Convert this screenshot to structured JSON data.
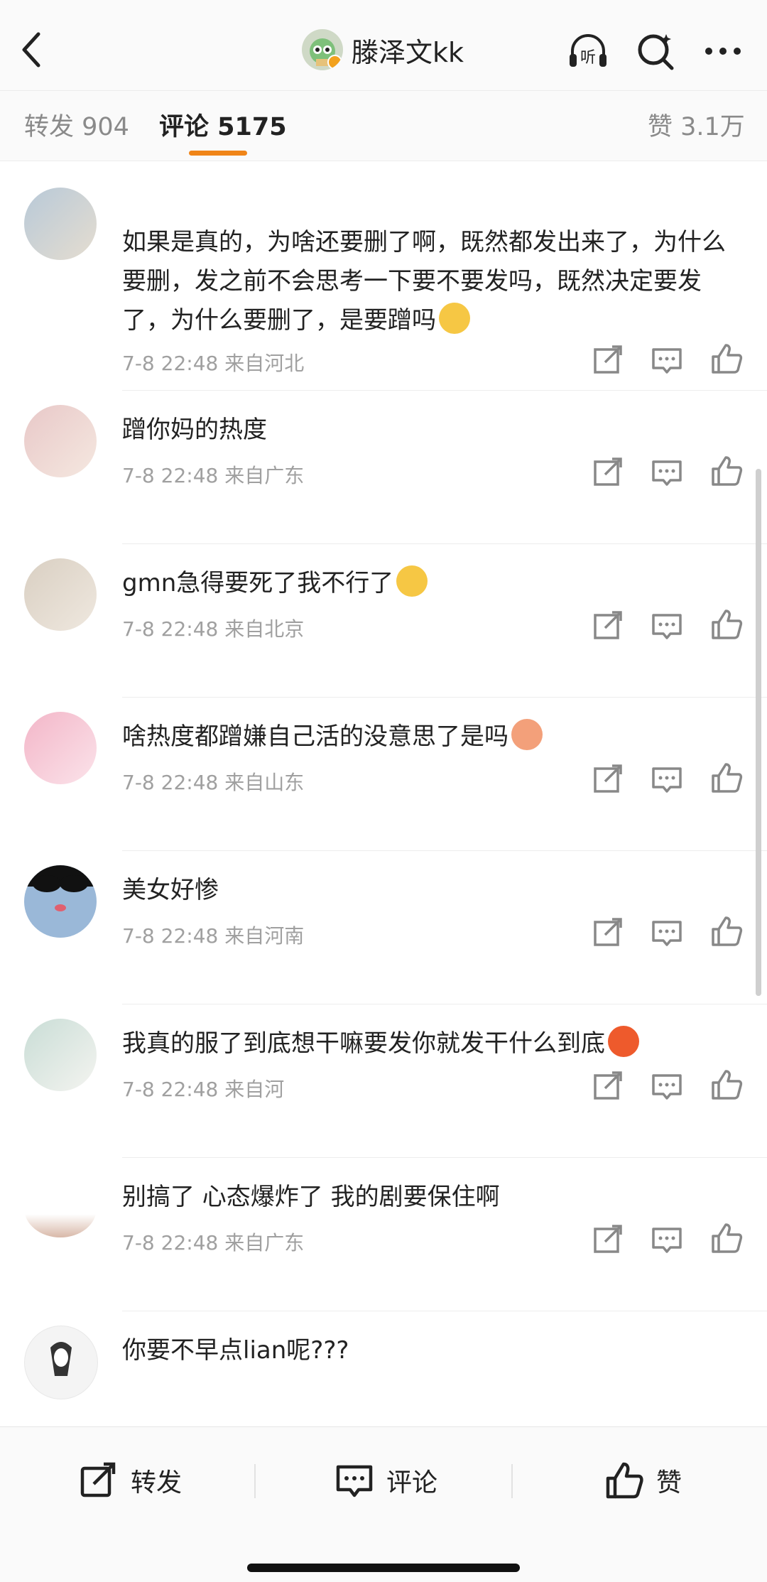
{
  "header": {
    "title": "滕泽文kk",
    "listen_label": "听"
  },
  "tabs": {
    "repost_label": "转发 904",
    "comment_label": "评论 5175",
    "like_label": "赞 3.1万"
  },
  "comments": [
    {
      "text": "如果是真的，为啥还要删了啊，既然都发出来了，为什么要删，发之前不会思考一下要不要发吗，既然决定要发了，为什么要删了，是要蹭吗",
      "meta": "7-8 22:48 来自河北",
      "emoji_color": "#f6c744"
    },
    {
      "text": "蹭你妈的热度",
      "meta": "7-8 22:48 来自广东"
    },
    {
      "text": "gmn急得要死了我不行了",
      "meta": "7-8 22:48 来自北京",
      "emoji_color": "#f6c744"
    },
    {
      "text": "啥热度都蹭嫌自己活的没意思了是吗",
      "meta": "7-8 22:48 来自山东",
      "emoji_color": "#f3a07a"
    },
    {
      "text": "美女好惨",
      "meta": "7-8 22:48 来自河南"
    },
    {
      "text": "我真的服了到底想干嘛要发你就发干什么到底",
      "meta": "7-8 22:48 来自河",
      "emoji_color": "#ee5a2c"
    },
    {
      "text": "别搞了 心态爆炸了 我的剧要保住啊",
      "meta": "7-8 22:48 来自广东"
    },
    {
      "text": "你要不早点lian呢???",
      "meta": ""
    }
  ],
  "bottom_bar": {
    "repost_label": "转发",
    "comment_label": "评论",
    "like_label": "赞"
  },
  "colors": {
    "accent": "#f08518",
    "meta_text": "#a0a0a0"
  }
}
